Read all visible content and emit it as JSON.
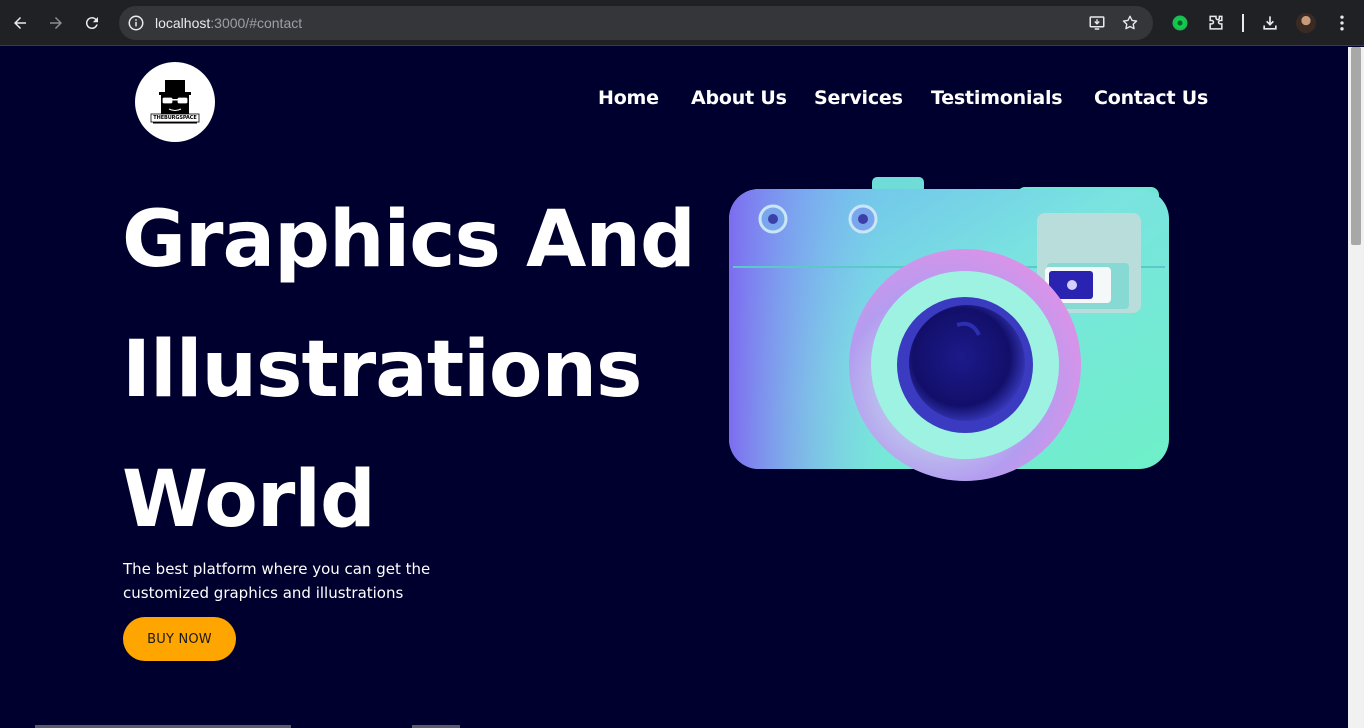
{
  "browser": {
    "url_host": "localhost",
    "url_rest": ":3000/#contact"
  },
  "nav": {
    "items": [
      "Home",
      "About Us",
      "Services",
      "Testimonials",
      "Contact Us"
    ]
  },
  "logo": {
    "text": "THEBURGSPACE"
  },
  "hero": {
    "title_lines": [
      "Graphics And",
      "Illustrations",
      "World"
    ],
    "subtitle_line1": "The best platform where you can get the",
    "subtitle_line2": "customized graphics and illustrations",
    "button_label": "BUY NOW"
  },
  "colors": {
    "background": "#00002e",
    "button": "#ffa500"
  },
  "icons": [
    "back-icon",
    "forward-icon",
    "reload-icon",
    "site-info-icon",
    "install-app-icon",
    "bookmark-star-icon",
    "extension-green-icon",
    "extensions-puzzle-icon",
    "download-icon",
    "profile-avatar",
    "menu-kebab-icon",
    "camera-illustration"
  ]
}
